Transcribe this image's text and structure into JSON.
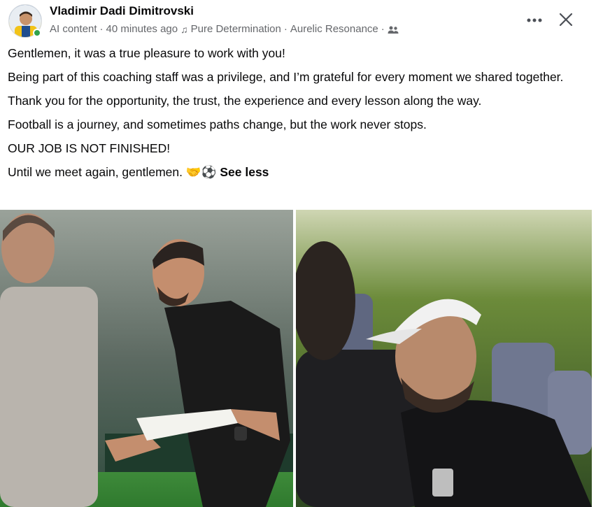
{
  "post": {
    "author_name": "Vladimir Dadi Dimitrovski",
    "meta": {
      "ai_label": "AI content",
      "time": "40 minutes ago",
      "music_note_icon": "music-note-icon",
      "song": "Pure Determination",
      "artist": "Aurelic Resonance",
      "audience_icon": "friends-icon"
    },
    "more_icon": "more-options-icon",
    "close_icon": "close-icon",
    "paragraphs": [
      "Gentlemen, it was a true pleasure to work with you!",
      "Being part of this coaching staff was a privilege, and I’m grateful for every moment we shared together.",
      "Thank you for the opportunity, the trust, the experience and every lesson along the way.",
      "Football is a journey, and sometimes paths change, but the work never stops.",
      "OUR JOB IS NOT FINISHED!",
      "Until we meet again, gentlemen."
    ],
    "last_emojis": "🤝⚽",
    "see_less_label": "See less",
    "colors": {
      "text_primary": "#080809",
      "text_secondary": "#65676b",
      "online": "#31a24c"
    }
  }
}
